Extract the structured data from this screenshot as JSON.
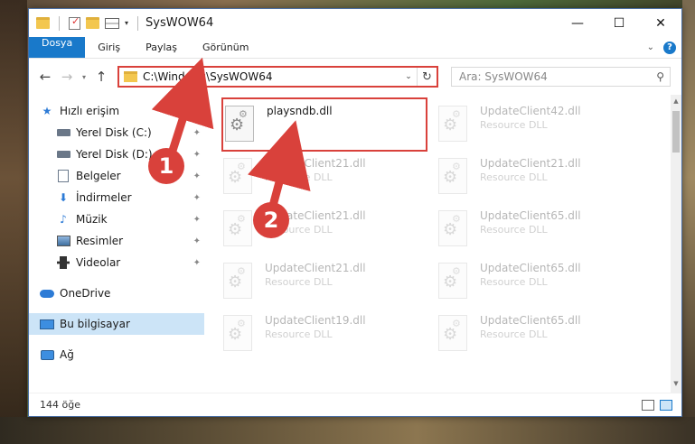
{
  "window": {
    "title": "SysWOW64"
  },
  "ribbon": {
    "tabs": [
      {
        "label": "Dosya"
      },
      {
        "label": "Giriş"
      },
      {
        "label": "Paylaş"
      },
      {
        "label": "Görünüm"
      }
    ]
  },
  "address": {
    "path": "C:\\Windows\\SysWOW64",
    "search_placeholder": "Ara: SysWOW64"
  },
  "nav": {
    "quick_access": "Hızlı erişim",
    "pinned": [
      {
        "label": "Yerel Disk (C:)",
        "icon": "drive-icon"
      },
      {
        "label": "Yerel Disk (D:)",
        "icon": "drive-icon"
      },
      {
        "label": "Belgeler",
        "icon": "documents-icon"
      },
      {
        "label": "İndirmeler",
        "icon": "downloads-icon"
      },
      {
        "label": "Müzik",
        "icon": "music-icon"
      },
      {
        "label": "Resimler",
        "icon": "pictures-icon"
      },
      {
        "label": "Videolar",
        "icon": "videos-icon"
      }
    ],
    "onedrive": "OneDrive",
    "this_pc": "Bu bilgisayar",
    "network": "Ağ"
  },
  "files": [
    {
      "name": "playsndb.dll",
      "type": "",
      "ghost": false,
      "highlight": true
    },
    {
      "name": "UpdateClient42.dll",
      "type": "Resource DLL",
      "ghost": true
    },
    {
      "name": "UpdateClient21.dll",
      "type": "Resource DLL",
      "ghost": true
    },
    {
      "name": "UpdateClient21.dll",
      "type": "Resource DLL",
      "ghost": true
    },
    {
      "name": "UpdateClient21.dll",
      "type": "Resource DLL",
      "ghost": true
    },
    {
      "name": "UpdateClient65.dll",
      "type": "Resource DLL",
      "ghost": true
    },
    {
      "name": "UpdateClient21.dll",
      "type": "Resource DLL",
      "ghost": true
    },
    {
      "name": "UpdateClient65.dll",
      "type": "Resource DLL",
      "ghost": true
    },
    {
      "name": "UpdateClient19.dll",
      "type": "Resource DLL",
      "ghost": true
    },
    {
      "name": "UpdateClient65.dll",
      "type": "Resource DLL",
      "ghost": true
    }
  ],
  "status": {
    "count": "144 öğe"
  },
  "callouts": {
    "one": "1",
    "two": "2"
  },
  "colors": {
    "accent": "#1979ca",
    "highlight": "#d9413b",
    "selected": "#cce4f7"
  }
}
